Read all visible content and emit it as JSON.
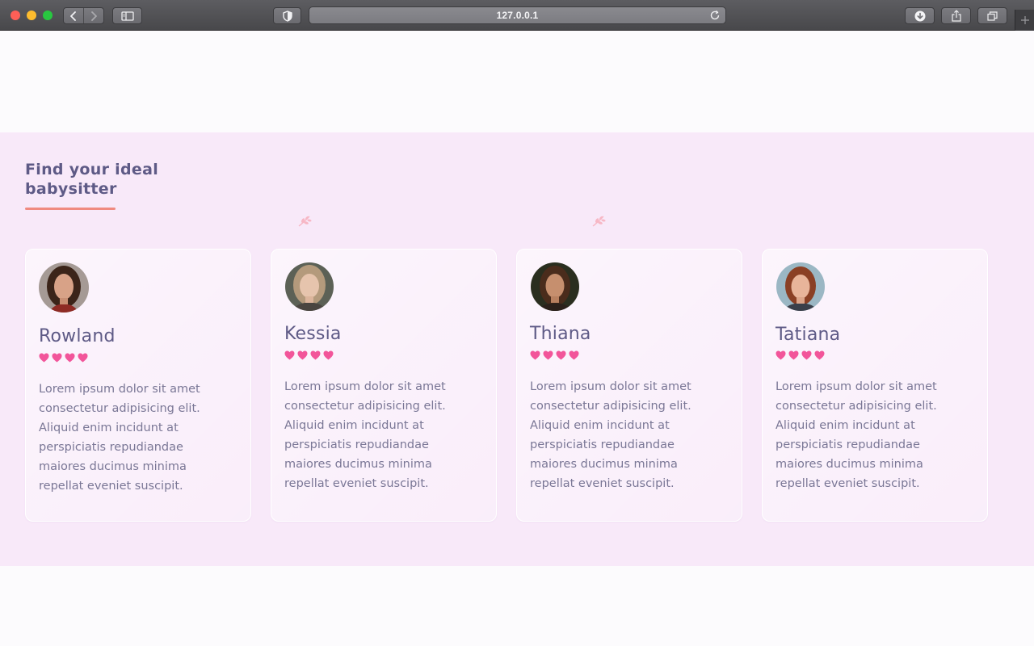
{
  "browser": {
    "url": "127.0.0.1",
    "icons": [
      "back-icon",
      "forward-icon",
      "sidebar-icon",
      "shield-icon",
      "reload-icon",
      "download-icon",
      "share-icon",
      "tabs-icon",
      "new-tab-icon"
    ]
  },
  "section": {
    "title": "Find your ideal babysitter",
    "accent_color": "#f08a80",
    "background_color": "#f8e9f9",
    "text_color": "#5e5a86"
  },
  "cards": [
    {
      "name": "Rowland",
      "rating": 4,
      "description": "Lorem ipsum dolor sit amet consectetur adipisicing elit. Aliquid enim incidunt at perspiciatis repudiandae maiores ducimus minima repellat eveniet suscipit."
    },
    {
      "name": "Kessia",
      "rating": 4,
      "description": "Lorem ipsum dolor sit amet consectetur adipisicing elit. Aliquid enim incidunt at perspiciatis repudiandae maiores ducimus minima repellat eveniet suscipit."
    },
    {
      "name": "Thiana",
      "rating": 4,
      "description": "Lorem ipsum dolor sit amet consectetur adipisicing elit. Aliquid enim incidunt at perspiciatis repudiandae maiores ducimus minima repellat eveniet suscipit."
    },
    {
      "name": "Tatiana",
      "rating": 4,
      "description": "Lorem ipsum dolor sit amet consectetur adipisicing elit. Aliquid enim incidunt at perspiciatis repudiandae maiores ducimus minima repellat eveniet suscipit."
    }
  ],
  "heart_color": "#f2559a"
}
